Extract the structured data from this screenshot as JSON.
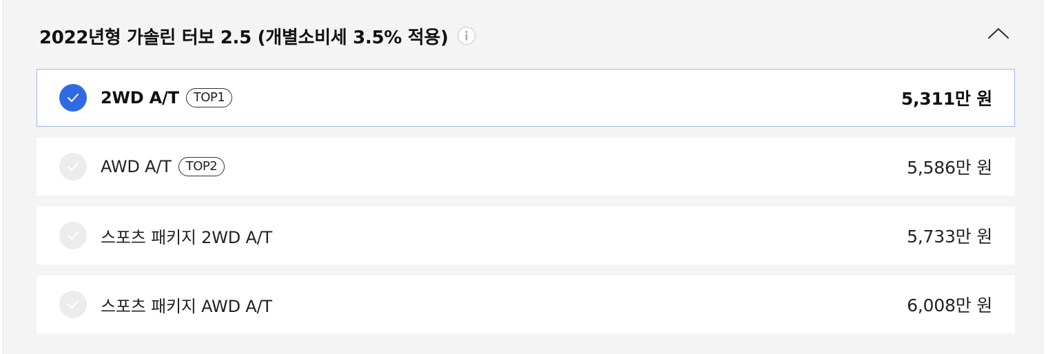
{
  "section": {
    "title": "2022년형 가솔린 터보 2.5 (개별소비세 3.5% 적용)",
    "info_icon": "info-circle-icon",
    "collapse_icon": "chevron-up-icon"
  },
  "options": [
    {
      "label": "2WD A/T",
      "badge": "TOP1",
      "price": "5,311만 원",
      "selected": true
    },
    {
      "label": "AWD A/T",
      "badge": "TOP2",
      "price": "5,586만 원",
      "selected": false
    },
    {
      "label": "스포츠 패키지 2WD A/T",
      "badge": "",
      "price": "5,733만 원",
      "selected": false
    },
    {
      "label": "스포츠 패키지 AWD A/T",
      "badge": "",
      "price": "6,008만 원",
      "selected": false
    }
  ],
  "colors": {
    "accent": "#2f6be0",
    "selected_border": "#9fb6ee",
    "panel_bg": "#f4f4f4",
    "unselected_check": "#ececec"
  }
}
